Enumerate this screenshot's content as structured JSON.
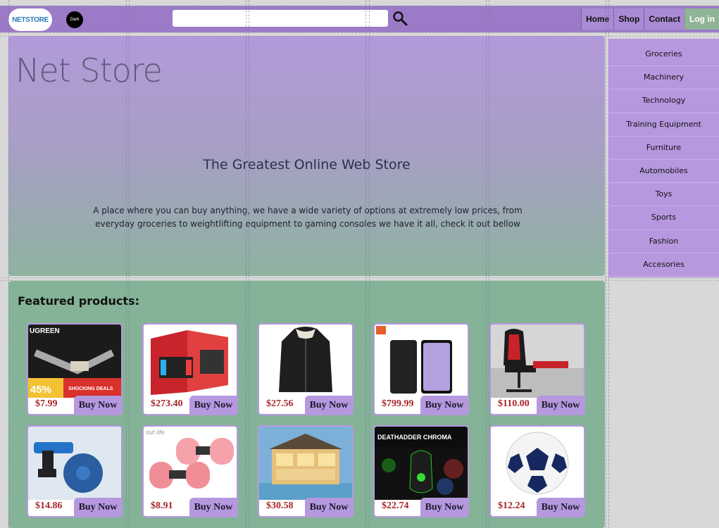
{
  "nav": {
    "logo_text": "NETSTORE",
    "dark_label": "Dark",
    "search_value": "",
    "links": [
      {
        "label": "Home"
      },
      {
        "label": "Shop"
      },
      {
        "label": "Contact"
      },
      {
        "label": "Log in"
      }
    ]
  },
  "hero": {
    "title": "Net Store",
    "subtitle": "The Greatest Online Web Store",
    "description": "A place where you can buy anything, we have a wide variety of options at extremely low prices, from everyday groceries to weightlifting equipment to gaming consoles we have it all, check it out bellow"
  },
  "sidebar": {
    "items": [
      {
        "label": "Groceries"
      },
      {
        "label": "Machinery"
      },
      {
        "label": "Technology"
      },
      {
        "label": "Training Equipment"
      },
      {
        "label": "Furniture"
      },
      {
        "label": "Automobiles"
      },
      {
        "label": "Toys"
      },
      {
        "label": "Sports"
      },
      {
        "label": "Fashion"
      },
      {
        "label": "Accesories"
      }
    ]
  },
  "featured": {
    "heading": "Featured products:",
    "buy_label": "Buy Now",
    "products": [
      {
        "price": "$7.99",
        "image": "hdmi-cable-image",
        "image_text": "UGREEN",
        "promo_text": "SHOCKING DEALS",
        "promo_percent": "45%"
      },
      {
        "price": "$273.40",
        "image": "game-console-image"
      },
      {
        "price": "$27.56",
        "image": "winter-jacket-image"
      },
      {
        "price": "$799.99",
        "image": "smartphone-image"
      },
      {
        "price": "$110.00",
        "image": "gaming-chair-image"
      },
      {
        "price": "$14.86",
        "image": "drill-pump-image"
      },
      {
        "price": "$8.91",
        "image": "dumbbells-image",
        "image_text": "out life"
      },
      {
        "price": "$30.58",
        "image": "dollhouse-image"
      },
      {
        "price": "$22.74",
        "image": "gaming-mouse-image",
        "image_text": "DEATHADDER CHROMA"
      },
      {
        "price": "$12.24",
        "image": "soccer-ball-image"
      }
    ]
  },
  "colors": {
    "nav_bg": "#9b7bc8",
    "accent_purple": "#b698df",
    "featured_bg": "#84b397",
    "price_red": "#a8262a",
    "login_green": "#8fb596"
  }
}
